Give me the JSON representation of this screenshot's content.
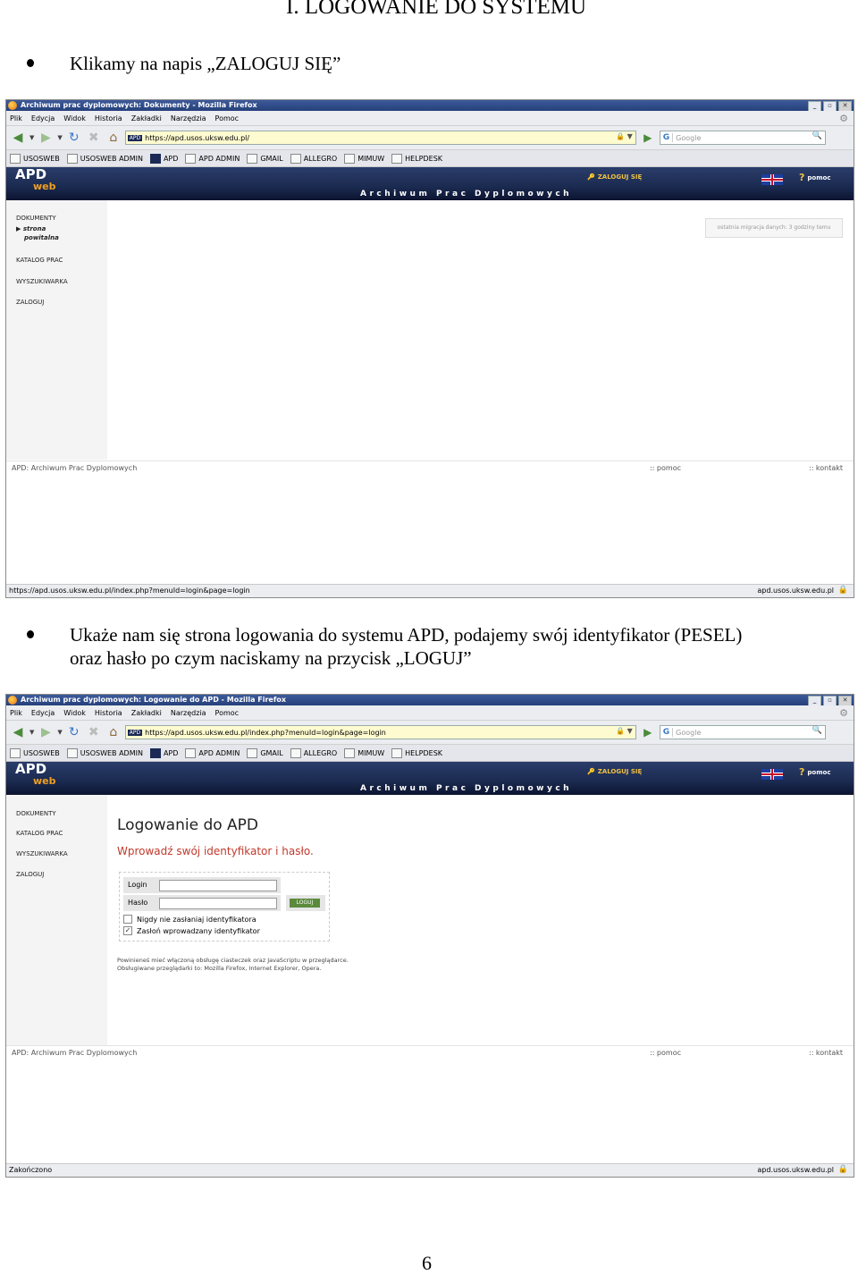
{
  "document": {
    "title": "I. LOGOWANIE DO SYSTEMU",
    "bullet1": "Klikamy na napis „ZALOGUJ SIĘ”",
    "bullet2_line1": "Ukaże nam się strona logowania do systemu APD, podajemy swój identyfikator (PESEL)",
    "bullet2_line2": "oraz hasło po czym naciskamy na przycisk „LOGUJ”",
    "page_number": "6"
  },
  "browser_common": {
    "menu": [
      "Plik",
      "Edycja",
      "Widok",
      "Historia",
      "Zakładki",
      "Narzędzia",
      "Pomoc"
    ],
    "bookmarks": [
      "USOSWEB",
      "USOSWEB ADMIN",
      "APD",
      "APD ADMIN",
      "GMAIL",
      "ALLEGRO",
      "MIMUW",
      "HELPDESK"
    ],
    "search_placeholder": "Google",
    "search_engine": "G",
    "apd_logo": "APD",
    "apd_logo_web": "web",
    "apd_tagline": "Archiwum Prac Dyplomowych",
    "zaloguj_link": "ZALOGUJ SIĘ",
    "pomoc_link": "pomoc",
    "footer_left": "APD: Archiwum Prac Dyplomowych",
    "footer_pomoc": ":: pomoc",
    "footer_kontakt": ":: kontakt",
    "status_domain": "apd.usos.uksw.edu.pl"
  },
  "screenshot1": {
    "window_title": "Archiwum prac dyplomowych: Dokumenty - Mozilla Firefox",
    "url": "https://apd.usos.uksw.edu.pl/",
    "sidebar": {
      "dokumenty": "DOKUMENTY",
      "strona": "strona",
      "powitalna": "powitalna",
      "katalog": "KATALOG PRAC",
      "wyszukiwarka": "WYSZUKIWARKA",
      "zaloguj": "ZALOGUJ"
    },
    "migration_notice": "ostatnia migracja danych: 3 godziny temu",
    "status_left": "https://apd.usos.uksw.edu.pl/index.php?menuId=login&page=login"
  },
  "screenshot2": {
    "window_title": "Archiwum prac dyplomowych: Logowanie do APD - Mozilla Firefox",
    "url": "https://apd.usos.uksw.edu.pl/index.php?menuId=login&page=login",
    "sidebar": {
      "dokumenty": "DOKUMENTY",
      "katalog": "KATALOG PRAC",
      "wyszukiwarka": "WYSZUKIWARKA",
      "zaloguj": "ZALOGUJ"
    },
    "login": {
      "title": "Logowanie do APD",
      "subtitle": "Wprowadź swój identyfikator i hasło.",
      "login_label": "Login",
      "password_label": "Hasło",
      "button": "LOGUJ",
      "checkbox1": "Nigdy nie zasłaniaj identyfikatora",
      "checkbox2": "Zasłoń wprowadzany identyfikator",
      "checkbox1_checked": false,
      "checkbox2_checked": true,
      "note_line1": "Powinieneś mieć włączoną obsługę ciasteczek oraz JavaScriptu w przeglądarce.",
      "note_line2": "Obsługiwane przeglądarki to: Mozilla Firefox, Internet Explorer, Opera."
    },
    "status_left": "Zakończono"
  }
}
